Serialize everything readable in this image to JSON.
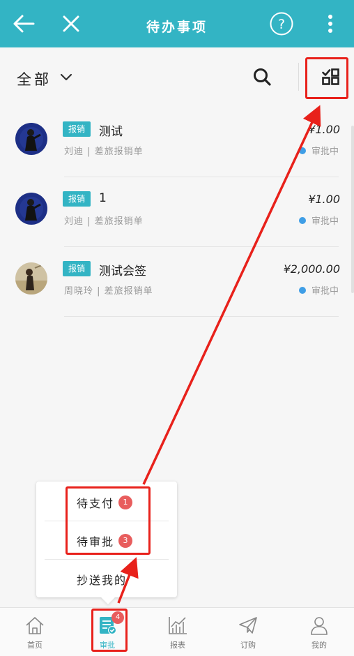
{
  "header": {
    "title": "待办事项",
    "back_icon": "arrow-left-icon",
    "close_icon": "close-icon",
    "help_icon": "question-circle-icon",
    "more_icon": "more-vertical-icon"
  },
  "filter": {
    "label": "全部",
    "search_icon": "search-icon",
    "grid_icon": "grid-check-icon"
  },
  "items": [
    {
      "tag": "报销",
      "title": "测试",
      "submitter": "刘迪",
      "doc_type": "差旅报销单",
      "amount": "¥1.00",
      "status": "审批中"
    },
    {
      "tag": "报销",
      "title": "1",
      "submitter": "刘迪",
      "doc_type": "差旅报销单",
      "amount": "¥1.00",
      "status": "审批中"
    },
    {
      "tag": "报销",
      "title": "测试会签",
      "submitter": "周晓玲",
      "doc_type": "差旅报销单",
      "amount": "¥2,000.00",
      "status": "审批中"
    }
  ],
  "popup": {
    "items": [
      {
        "label": "待支付",
        "badge": "1"
      },
      {
        "label": "待审批",
        "badge": "3"
      },
      {
        "label": "抄送我的",
        "badge": ""
      }
    ]
  },
  "tabs": [
    {
      "label": "首页",
      "icon": "home-icon"
    },
    {
      "label": "审批",
      "icon": "approval-icon",
      "badge": "4"
    },
    {
      "label": "报表",
      "icon": "chart-icon"
    },
    {
      "label": "订购",
      "icon": "paper-plane-icon"
    },
    {
      "label": "我的",
      "icon": "user-icon"
    }
  ],
  "colors": {
    "header_bg": "#33b4c4",
    "tag_bg": "#33b4c4",
    "status_dot": "#3f9ee6",
    "badge_bg": "#e85d5d",
    "annotation_red": "#e8211b"
  }
}
